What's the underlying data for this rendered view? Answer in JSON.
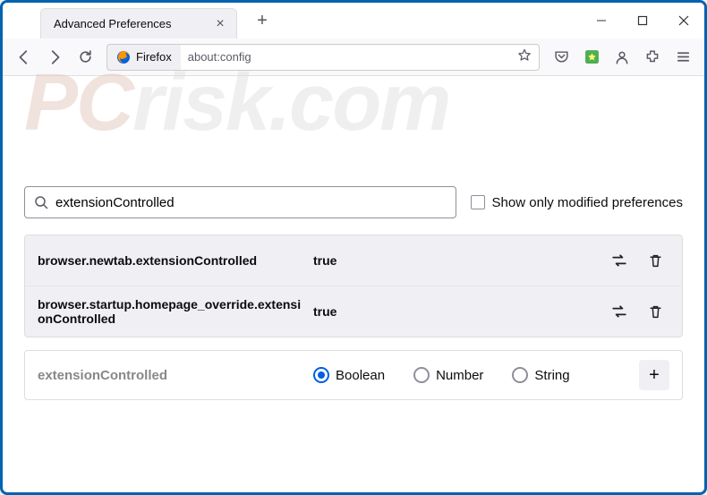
{
  "window": {
    "tab_title": "Advanced Preferences"
  },
  "toolbar": {
    "identity_label": "Firefox",
    "url": "about:config"
  },
  "search": {
    "value": "extensionControlled",
    "show_only_label": "Show only modified preferences"
  },
  "prefs": [
    {
      "name": "browser.newtab.extensionControlled",
      "value": "true"
    },
    {
      "name": "browser.startup.homepage_override.extensionControlled",
      "value": "true"
    }
  ],
  "new_pref": {
    "name": "extensionControlled",
    "options": {
      "boolean": "Boolean",
      "number": "Number",
      "string": "String"
    },
    "selected": "boolean"
  },
  "watermark": {
    "pc": "PC",
    "rest": "risk.com"
  }
}
